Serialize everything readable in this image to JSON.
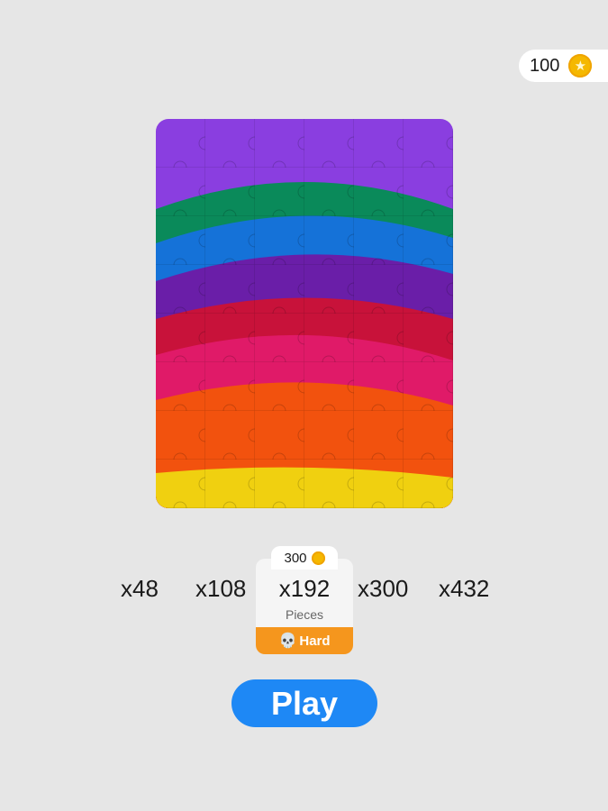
{
  "coins": {
    "count": "100",
    "icon": "star-coin-icon",
    "color": "#f5b800"
  },
  "puzzle": {
    "icon": "puzzle-preview-image",
    "bands": [
      "#8a3ee0",
      "#0a8a5a",
      "#1572d8",
      "#6a1ea8",
      "#c8123a",
      "#e01a68",
      "#f2520e",
      "#f0d010"
    ]
  },
  "piece_options": [
    {
      "label": "x48"
    },
    {
      "label": "x108"
    },
    {
      "label": "x192"
    },
    {
      "label": "x300"
    },
    {
      "label": "x432"
    }
  ],
  "selected": {
    "label": "x192",
    "price": "300",
    "unit": "Pieces",
    "difficulty": "Hard",
    "difficulty_icon": "skull-icon",
    "accent": "#f5961d"
  },
  "play_label": "Play",
  "play_color": "#1e88f5"
}
